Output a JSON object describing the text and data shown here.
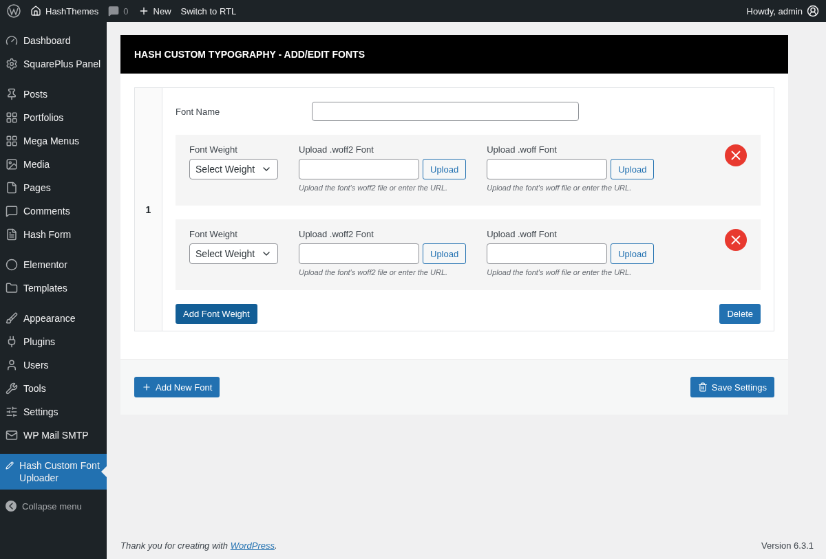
{
  "admin_bar": {
    "site": "HashThemes",
    "comments": "0",
    "new": "New",
    "rtl": "Switch to RTL",
    "greeting": "Howdy, admin"
  },
  "sidebar": {
    "groups": [
      [
        {
          "label": "Dashboard",
          "selected": false
        },
        {
          "label": "SquarePlus Panel",
          "selected": false
        }
      ],
      [
        {
          "label": "Posts",
          "selected": false
        },
        {
          "label": "Portfolios",
          "selected": false
        },
        {
          "label": "Mega Menus",
          "selected": false
        },
        {
          "label": "Media",
          "selected": false
        },
        {
          "label": "Pages",
          "selected": false
        },
        {
          "label": "Comments",
          "selected": false
        },
        {
          "label": "Hash Form",
          "selected": false
        }
      ],
      [
        {
          "label": "Elementor",
          "selected": false
        },
        {
          "label": "Templates",
          "selected": false
        }
      ],
      [
        {
          "label": "Appearance",
          "selected": false
        },
        {
          "label": "Plugins",
          "selected": false
        },
        {
          "label": "Users",
          "selected": false
        },
        {
          "label": "Tools",
          "selected": false
        },
        {
          "label": "Settings",
          "selected": false
        },
        {
          "label": "WP Mail SMTP",
          "selected": false
        }
      ],
      [
        {
          "label": "Hash Custom Font Uploader",
          "selected": true
        }
      ]
    ],
    "collapse": "Collapse menu"
  },
  "panel": {
    "title": "HASH CUSTOM TYPOGRAPHY - ADD/EDIT FONTS",
    "fonts": [
      {
        "number": "1",
        "name_label": "Font Name",
        "weights": [
          {
            "weight_label": "Font Weight",
            "weight_select": "Select Weight",
            "woff2_label": "Upload .woff2 Font",
            "woff2_button": "Upload",
            "woff2_hint": "Upload the font's woff2 file or enter the URL.",
            "woff_label": "Upload .woff Font",
            "woff_button": "Upload",
            "woff_hint": "Upload the font's woff file or enter the URL."
          },
          {
            "weight_label": "Font Weight",
            "weight_select": "Select Weight",
            "woff2_label": "Upload .woff2 Font",
            "woff2_button": "Upload",
            "woff2_hint": "Upload the font's woff2 file or enter the URL.",
            "woff_label": "Upload .woff Font",
            "woff_button": "Upload",
            "woff_hint": "Upload the font's woff file or enter the URL."
          }
        ],
        "add_weight": "Add Font Weight",
        "delete": "Delete"
      }
    ],
    "add_font": "Add New Font",
    "save": "Save Settings"
  },
  "footer": {
    "before": "Thank you for creating with ",
    "link": "WordPress",
    "after": ".",
    "version": "Version 6.3.1"
  }
}
